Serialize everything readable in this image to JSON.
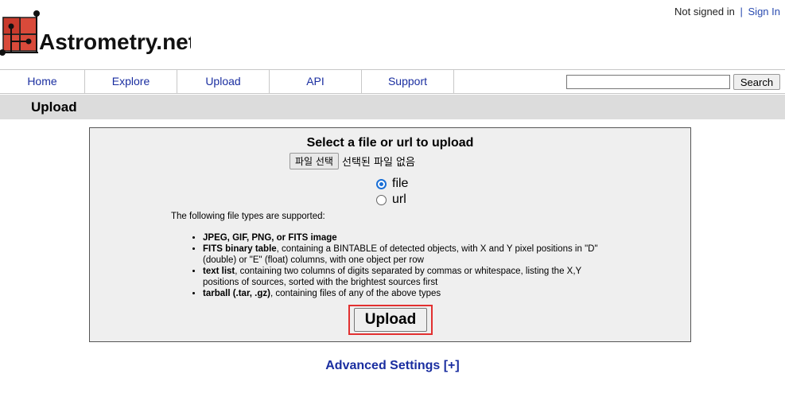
{
  "header": {
    "logo_text": "Astrometry.net",
    "auth_status": "Not signed in",
    "auth_separator": "|",
    "sign_in_label": "Sign In"
  },
  "nav": {
    "items": [
      {
        "label": "Home"
      },
      {
        "label": "Explore"
      },
      {
        "label": "Upload"
      },
      {
        "label": "API"
      },
      {
        "label": "Support"
      }
    ],
    "search": {
      "value": "",
      "button_label": "Search"
    }
  },
  "page_title": "Upload",
  "upload_panel": {
    "title": "Select a file or url to upload",
    "file_button_label": "파일 선택",
    "file_status": "선택된 파일 없음",
    "source_options": [
      {
        "label": "file",
        "checked": true
      },
      {
        "label": "url",
        "checked": false
      }
    ],
    "supported_intro": "The following file types are supported:",
    "supported_types": [
      {
        "name": "JPEG, GIF, PNG, or FITS image",
        "desc": ""
      },
      {
        "name": "FITS binary table",
        "desc": ", containing a BINTABLE of detected objects, with X and Y pixel positions in \"D\" (double) or \"E\" (float) columns, with one object per row"
      },
      {
        "name": "text list",
        "desc": ", containing two columns of digits separated by commas or whitespace, listing the X,Y positions of sources, sorted with the brightest sources first"
      },
      {
        "name": "tarball (.tar, .gz)",
        "desc": ", containing files of any of the above types"
      }
    ],
    "upload_button_label": "Upload"
  },
  "advanced_settings_label": "Advanced Settings [+]",
  "colors": {
    "link": "#1a2ea0",
    "title_bar": "#dcdcdc",
    "panel_bg": "#efefef",
    "highlight_outline": "#e23030",
    "logo_red": "#d94a3a"
  },
  "icons": {
    "logo": "astrometry-grid-logo-icon"
  }
}
